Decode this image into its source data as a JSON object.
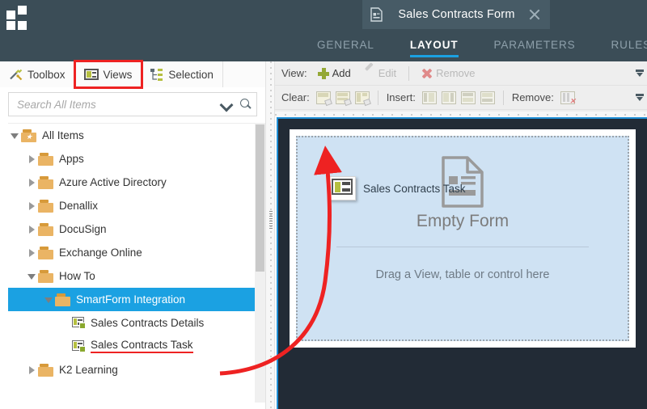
{
  "app": {
    "logo_icon": "grid-squares-logo",
    "accent_blue": "#1ba1e2",
    "topbar_bg": "#3b4d57",
    "highlight_red": "#ee2222"
  },
  "document_tab": {
    "icon": "form-document-icon",
    "title": "Sales Contracts Form",
    "close_icon": "close-icon"
  },
  "ribbon": {
    "tabs": [
      {
        "label": "GENERAL",
        "active": false
      },
      {
        "label": "LAYOUT",
        "active": true
      },
      {
        "label": "PARAMETERS",
        "active": false
      },
      {
        "label": "RULES",
        "active": false
      }
    ]
  },
  "left_panel": {
    "tabs": [
      {
        "label": "Toolbox",
        "icon": "toolbox-icon",
        "highlighted": false
      },
      {
        "label": "Views",
        "icon": "views-icon",
        "highlighted": true
      },
      {
        "label": "Selection",
        "icon": "selection-icon",
        "highlighted": false
      }
    ],
    "search": {
      "placeholder": "Search All Items",
      "value": "",
      "dropdown_icon": "chevron-down-icon",
      "search_icon": "search-icon"
    },
    "tree": [
      {
        "label": "All Items",
        "indent": 0,
        "twist": "open",
        "icon": "star-folder-icon",
        "selected": false,
        "underlined": false
      },
      {
        "label": "Apps",
        "indent": 1,
        "twist": "closed",
        "icon": "folder-icon",
        "selected": false,
        "underlined": false
      },
      {
        "label": "Azure Active Directory",
        "indent": 1,
        "twist": "closed",
        "icon": "folder-icon",
        "selected": false,
        "underlined": false
      },
      {
        "label": "Denallix",
        "indent": 1,
        "twist": "closed",
        "icon": "folder-icon",
        "selected": false,
        "underlined": false
      },
      {
        "label": "DocuSign",
        "indent": 1,
        "twist": "closed",
        "icon": "folder-icon",
        "selected": false,
        "underlined": false
      },
      {
        "label": "Exchange Online",
        "indent": 1,
        "twist": "closed",
        "icon": "folder-icon",
        "selected": false,
        "underlined": false
      },
      {
        "label": "How To",
        "indent": 1,
        "twist": "open",
        "icon": "folder-icon",
        "selected": false,
        "underlined": false
      },
      {
        "label": "SmartForm Integration",
        "indent": 2,
        "twist": "open",
        "icon": "folder-icon",
        "selected": true,
        "underlined": false
      },
      {
        "label": "Sales Contracts Details",
        "indent": 3,
        "twist": "none",
        "icon": "view-icon",
        "selected": false,
        "underlined": false
      },
      {
        "label": "Sales Contracts Task",
        "indent": 3,
        "twist": "none",
        "icon": "view-icon",
        "selected": false,
        "underlined": true
      },
      {
        "label": "K2 Learning",
        "indent": 1,
        "twist": "closed",
        "icon": "folder-icon",
        "selected": false,
        "underlined": false
      }
    ]
  },
  "toolbar": {
    "row1": {
      "label": "View:",
      "buttons": [
        {
          "label": "Add",
          "icon": "plus-icon",
          "disabled": false
        },
        {
          "label": "Edit",
          "icon": "pencil-icon",
          "disabled": true
        },
        {
          "label": "Remove",
          "icon": "x-icon",
          "disabled": true
        }
      ],
      "overflow_icon": "toolbar-overflow-icon"
    },
    "row2": {
      "clear_label": "Clear:",
      "clear_icons": [
        "clear-row-icon",
        "clear-column-icon",
        "clear-all-icon"
      ],
      "insert_label": "Insert:",
      "insert_icons": [
        "insert-column-left-icon",
        "insert-column-right-icon",
        "insert-row-above-icon",
        "insert-row-below-icon"
      ],
      "remove_label": "Remove:",
      "remove_icons": [
        "remove-column-icon"
      ],
      "overflow_icon": "toolbar-overflow-icon"
    }
  },
  "canvas": {
    "empty_form_icon": "empty-form-document-icon",
    "empty_form_label": "Empty Form",
    "drop_hint": "Drag a View, table or control here",
    "drag_ghost": {
      "icon": "view-icon",
      "label": "Sales Contracts Task"
    },
    "annotation": {
      "arrow": "red-curved-arrow",
      "from": "Sales Contracts Task",
      "to": "form drop zone"
    }
  }
}
